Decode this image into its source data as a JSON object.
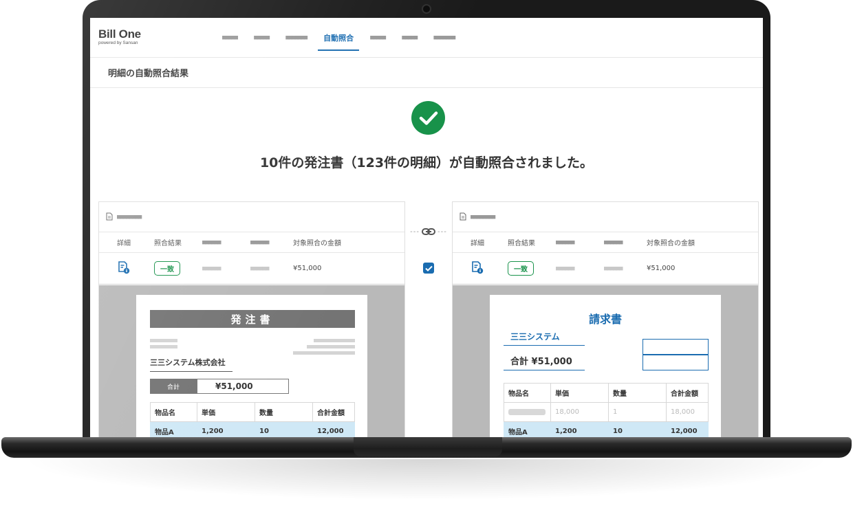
{
  "app": {
    "logo": "Bill One",
    "logo_sub": "powered by Sansan"
  },
  "nav": {
    "items": [
      {
        "label": "■■■■■"
      },
      {
        "label": "■■■■■"
      },
      {
        "label": "■■■■■■■"
      },
      {
        "label": "自動照合"
      },
      {
        "label": "■■■■■"
      },
      {
        "label": "■■■■■"
      },
      {
        "label": "■■■■■■■"
      }
    ]
  },
  "page": {
    "title": "明細の自動照合結果",
    "success_message": "10件の発注書（123件の明細）が自動照合されました。"
  },
  "left_panel": {
    "title": "■■■■■■■■",
    "headers": [
      "詳細",
      "照合結果",
      "■■■■■■",
      "■■■■■■",
      "対象照合の金額"
    ],
    "row": {
      "result": "一致",
      "col3": "■■■■■■",
      "col4": "■■■■■■",
      "amount": "¥51,000"
    },
    "doc": {
      "title": "発注書",
      "company": "三三システム株式会社",
      "total_label": "合計",
      "total_value": "¥51,000",
      "table": {
        "headers": [
          "物品名",
          "単価",
          "数量",
          "合計金額"
        ],
        "rows": [
          [
            "物品A",
            "1,200",
            "10",
            "12,000"
          ]
        ]
      }
    }
  },
  "right_panel": {
    "title": "■■■■■■■■",
    "headers": [
      "詳細",
      "照合結果",
      "■■■■■■",
      "■■■■■■",
      "対象照合の金額"
    ],
    "row": {
      "result": "一致",
      "col3": "■■■■■■",
      "col4": "■■■■■■",
      "amount": "¥51,000"
    },
    "doc": {
      "title": "請求書",
      "company": "三三システム",
      "total": "合計 ¥51,000",
      "table": {
        "headers": [
          "物品名",
          "単価",
          "数量",
          "合計金額"
        ],
        "muted_row": [
          "",
          "18,000",
          "1",
          "18,000"
        ],
        "rows": [
          [
            "物品A",
            "1,200",
            "10",
            "12,000"
          ]
        ]
      }
    }
  },
  "colors": {
    "accent": "#1a6cb0",
    "success": "#18924a",
    "highlight": "#cfe8f6"
  }
}
